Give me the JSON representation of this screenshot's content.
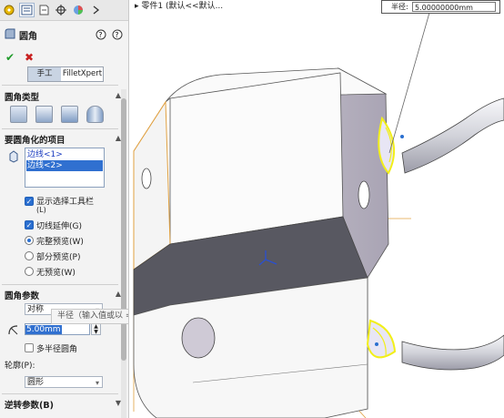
{
  "panel": {
    "title": "圆角",
    "manual_tab": "手工",
    "filletxpert_tab": "FilletXpert",
    "sections": {
      "fillet_type": "圆角类型",
      "items_to_fillet": "要圆角化的项目",
      "fillet_params": "圆角参数",
      "reverse_params": "逆转参数(B)"
    },
    "edges": [
      "边线<1>",
      "边线<2>"
    ],
    "options": {
      "show_selection_toolbar": "显示选择工具栏",
      "show_selection_toolbar_hint": "(L)",
      "tangent_propagation": "切线延伸(G)",
      "full_preview": "完整预览(W)",
      "partial_preview": "部分预览(P)",
      "no_preview": "无预览(W)"
    },
    "params": {
      "method": "对称",
      "radius_value": "5.00mm",
      "multi_radius": "多半径圆角",
      "profile_label": "轮廓(P):",
      "profile_value": "圆形"
    },
    "tooltip": "半径（输入值或以 = 开始，以创建方程式）"
  },
  "viewport": {
    "breadcrumb": "零件1 (默认<<默认...",
    "callout_label": "半径:",
    "callout_value": "5.00000000mm"
  },
  "colors": {
    "selection_blue": "#3070d0",
    "highlight_yellow": "#f2ef1a",
    "edge_orange": "#e0a040"
  }
}
